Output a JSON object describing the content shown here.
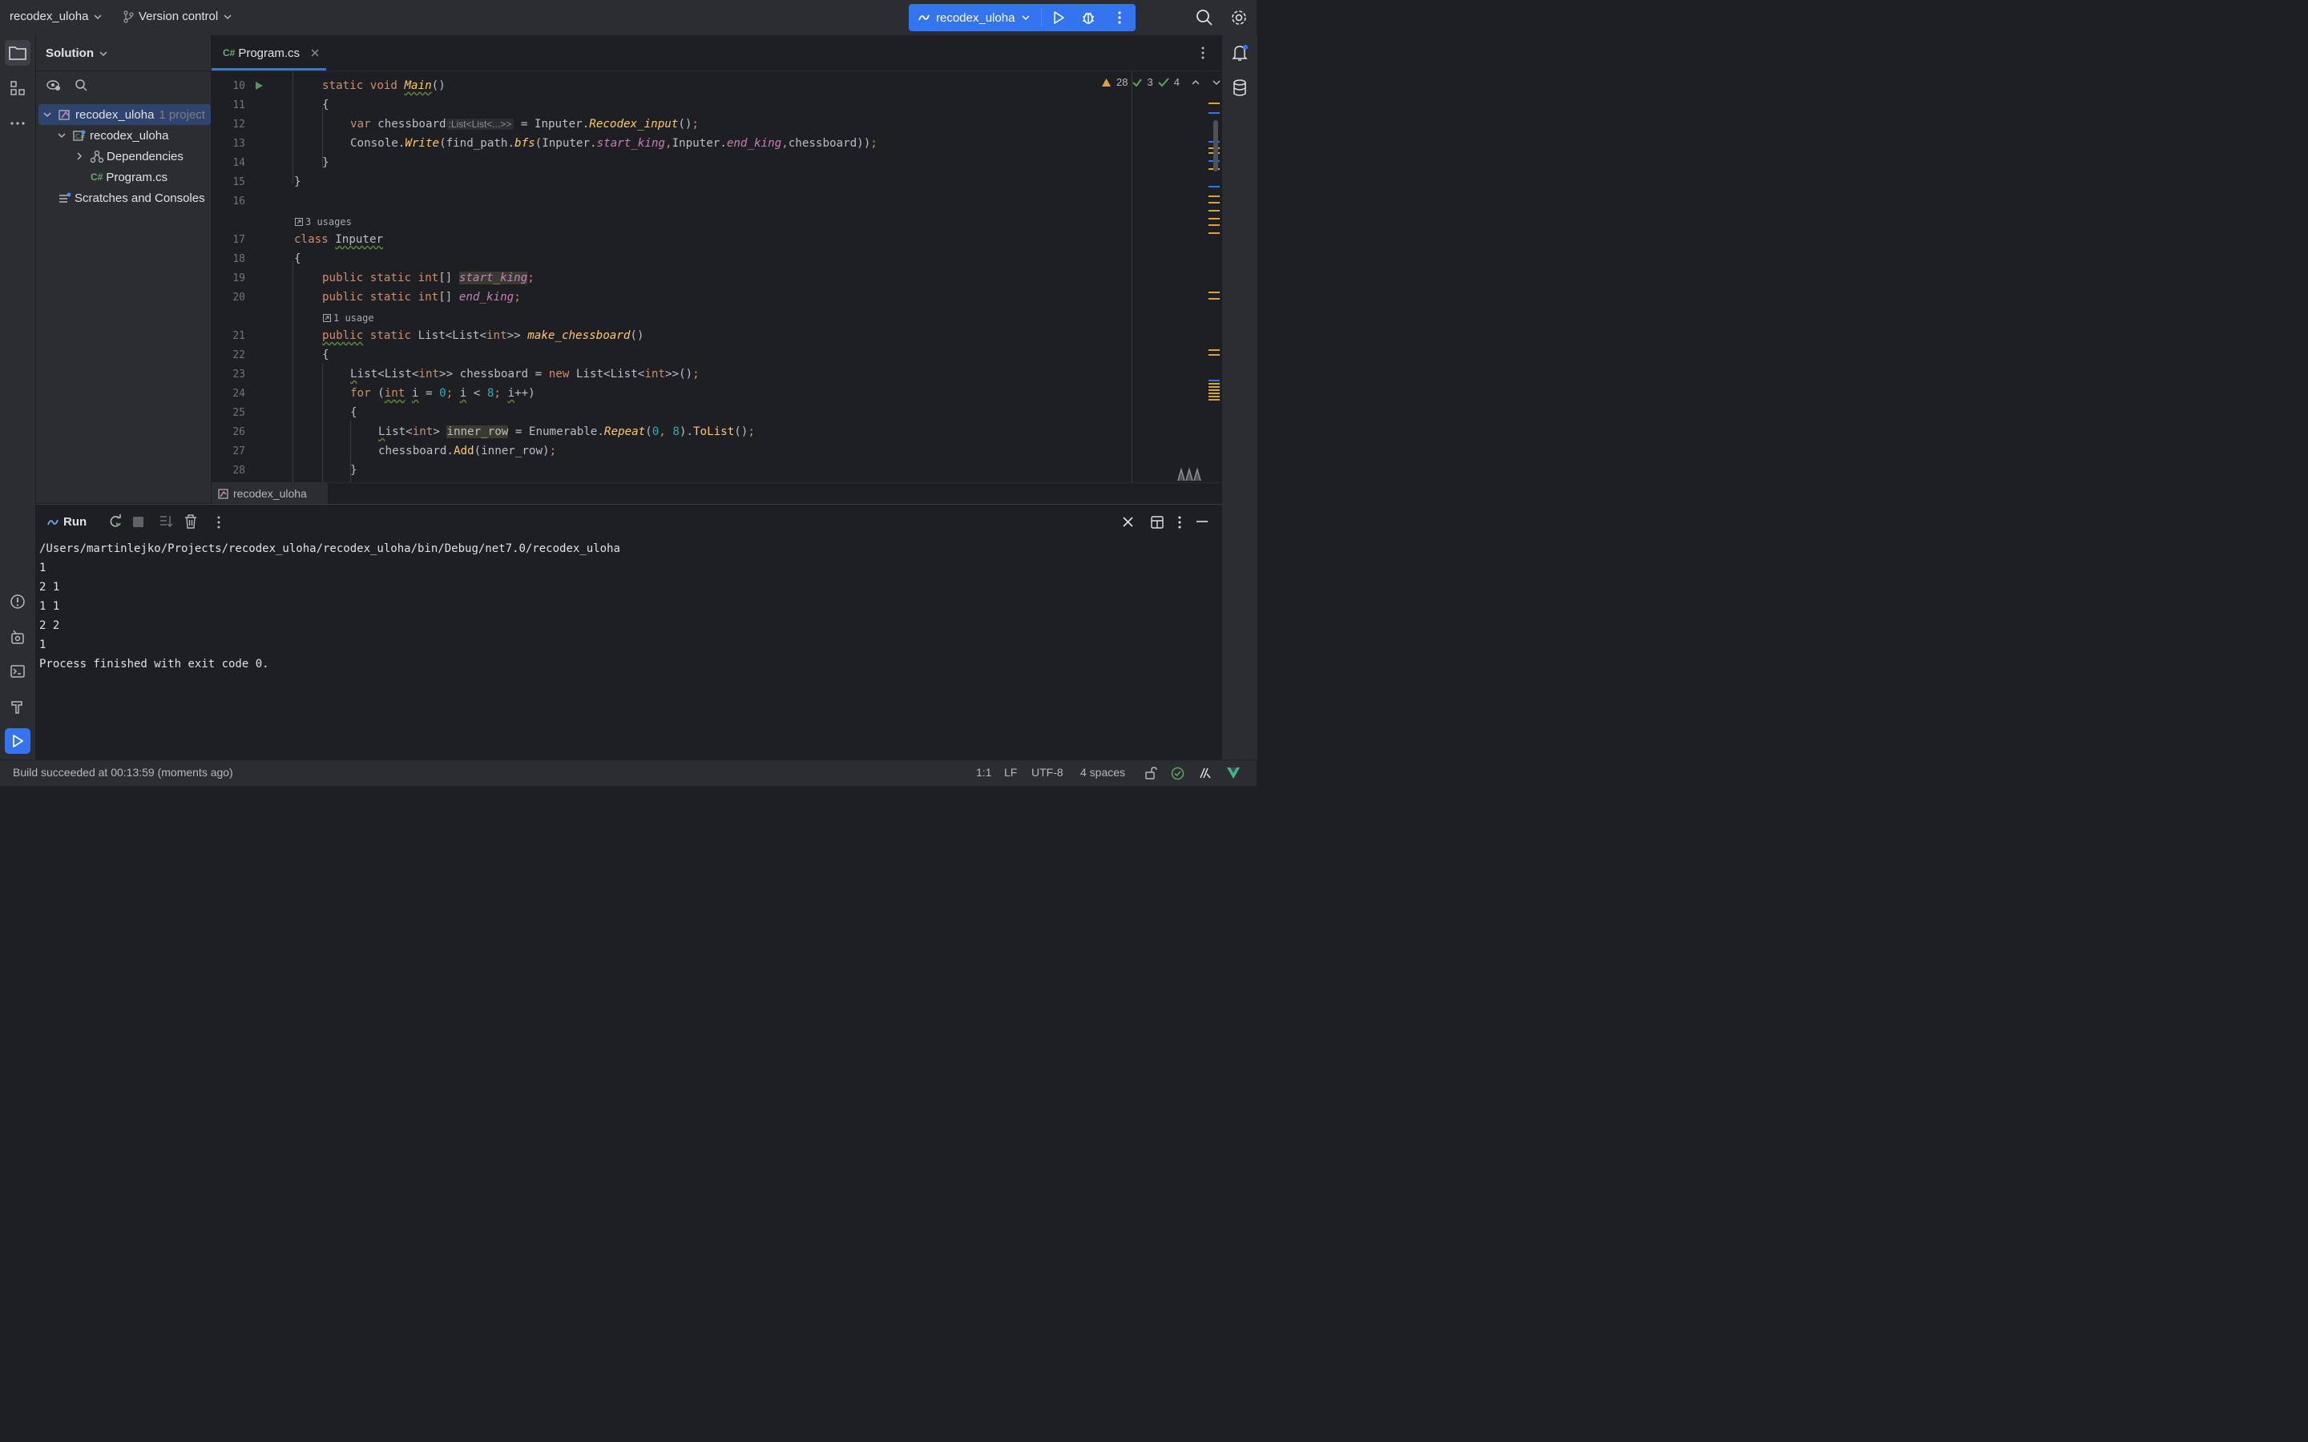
{
  "topbar": {
    "project_name": "recodex_uloha",
    "vcs_label": "Version control",
    "run_config": "recodex_uloha"
  },
  "project_panel": {
    "title": "Solution",
    "tree": [
      {
        "label": "recodex_uloha",
        "suffix": "1 project"
      },
      {
        "label": "recodex_uloha",
        "suffix": ""
      },
      {
        "label": "Dependencies",
        "suffix": ""
      },
      {
        "label": "Program.cs",
        "suffix": ""
      },
      {
        "label": "Scratches and Consoles",
        "suffix": ""
      }
    ]
  },
  "editor": {
    "tab_label": "Program.cs",
    "tab_lang": "C#",
    "inspections": {
      "warnings": "28",
      "weak": "3",
      "ok": "4"
    },
    "usages_3": "3 usages",
    "usages_1": "1 usage",
    "type_hint": ":List<List<...>>",
    "line_numbers": [
      "10",
      "11",
      "12",
      "13",
      "14",
      "15",
      "16",
      "17",
      "18",
      "19",
      "20",
      "21",
      "22",
      "23",
      "24",
      "25",
      "26",
      "27",
      "28"
    ],
    "breadcrumb": "recodex_uloha"
  },
  "run_panel": {
    "title": "Run",
    "output": [
      "/Users/martinlejko/Projects/recodex_uloha/recodex_uloha/bin/Debug/net7.0/recodex_uloha",
      "1",
      "2 1",
      "1 1",
      "2 2",
      "1",
      "Process finished with exit code 0."
    ]
  },
  "statusbar": {
    "build": "Build succeeded at 00:13:59  (moments ago)",
    "position": "1:1",
    "line_sep": "LF",
    "encoding": "UTF-8",
    "indent": "4 spaces"
  }
}
